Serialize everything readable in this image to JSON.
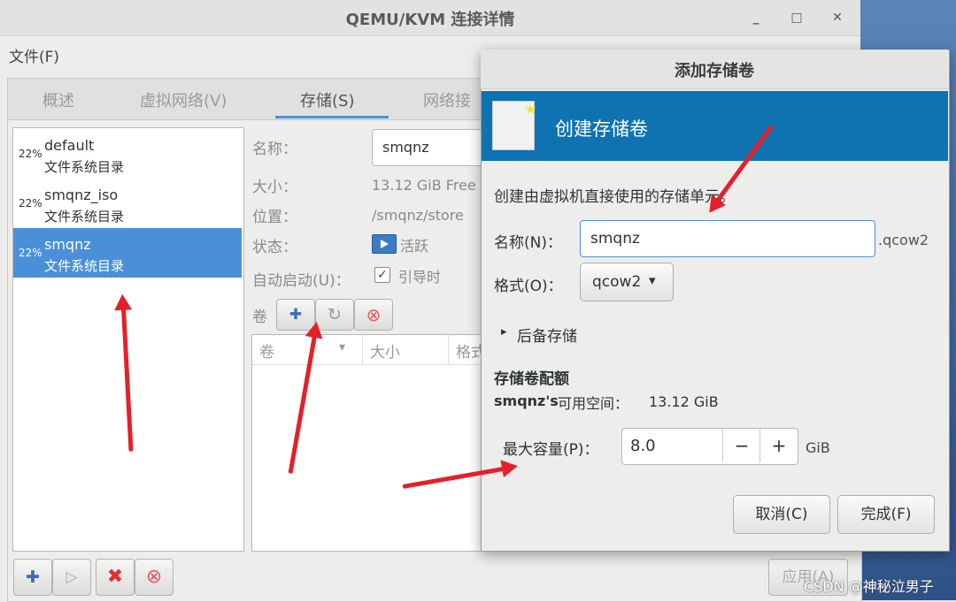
{
  "window": {
    "title": "QEMU/KVM 连接详情",
    "min": "_",
    "max": "□",
    "close": "✕"
  },
  "menu": {
    "file": "文件(F)"
  },
  "tabs": [
    {
      "label": "概述"
    },
    {
      "label": "虚拟网络(V)"
    },
    {
      "label": "存储(S)"
    },
    {
      "label": "网络接"
    }
  ],
  "pools": [
    {
      "pct": "22%",
      "name": "default",
      "type": "文件系统目录"
    },
    {
      "pct": "22%",
      "name": "smqnz_iso",
      "type": "文件系统目录"
    },
    {
      "pct": "22%",
      "name": "smqnz",
      "type": "文件系统目录"
    }
  ],
  "details": {
    "name_label": "名称：",
    "name_value": "smqnz",
    "size_label": "大小：",
    "size_value": "13.12 GiB Free",
    "location_label": "位置：",
    "location_value": "/smqnz/store",
    "state_label": "状态：",
    "state_value": "活跃",
    "autostart_label": "自动启动(U)：",
    "autostart_value": "引导时",
    "volumes_label": "卷"
  },
  "vol_table": {
    "col_vol": "卷",
    "col_size": "大小",
    "col_format": "格式"
  },
  "apply_button": "应用(A)",
  "dialog": {
    "title": "添加存储卷",
    "header": "创建存储卷",
    "description": "创建由虚拟机直接使用的存储单元。",
    "name_label": "名称(N)：",
    "name_value": "smqnz",
    "name_suffix": ".qcow2",
    "format_label": "格式(O)：",
    "format_value": "qcow2",
    "backing": "后备存储",
    "quota_title": "存储卷配额",
    "pool_name": "smqnz's",
    "available_label": "可用空间：",
    "available_value": "13.12 GiB",
    "max_label": "最大容量(P)：",
    "max_value": "8.0",
    "unit": "GiB",
    "minus": "−",
    "plus": "+",
    "cancel": "取消(C)",
    "finish": "完成(F)"
  },
  "icons": {
    "plus": "✚",
    "play": "▷",
    "delete": "✖",
    "stop": "⊗",
    "refresh": "↻",
    "dropdown": "▾",
    "expander": "▸",
    "check": "✓"
  },
  "watermark": "CSDN @神秘泣男子"
}
